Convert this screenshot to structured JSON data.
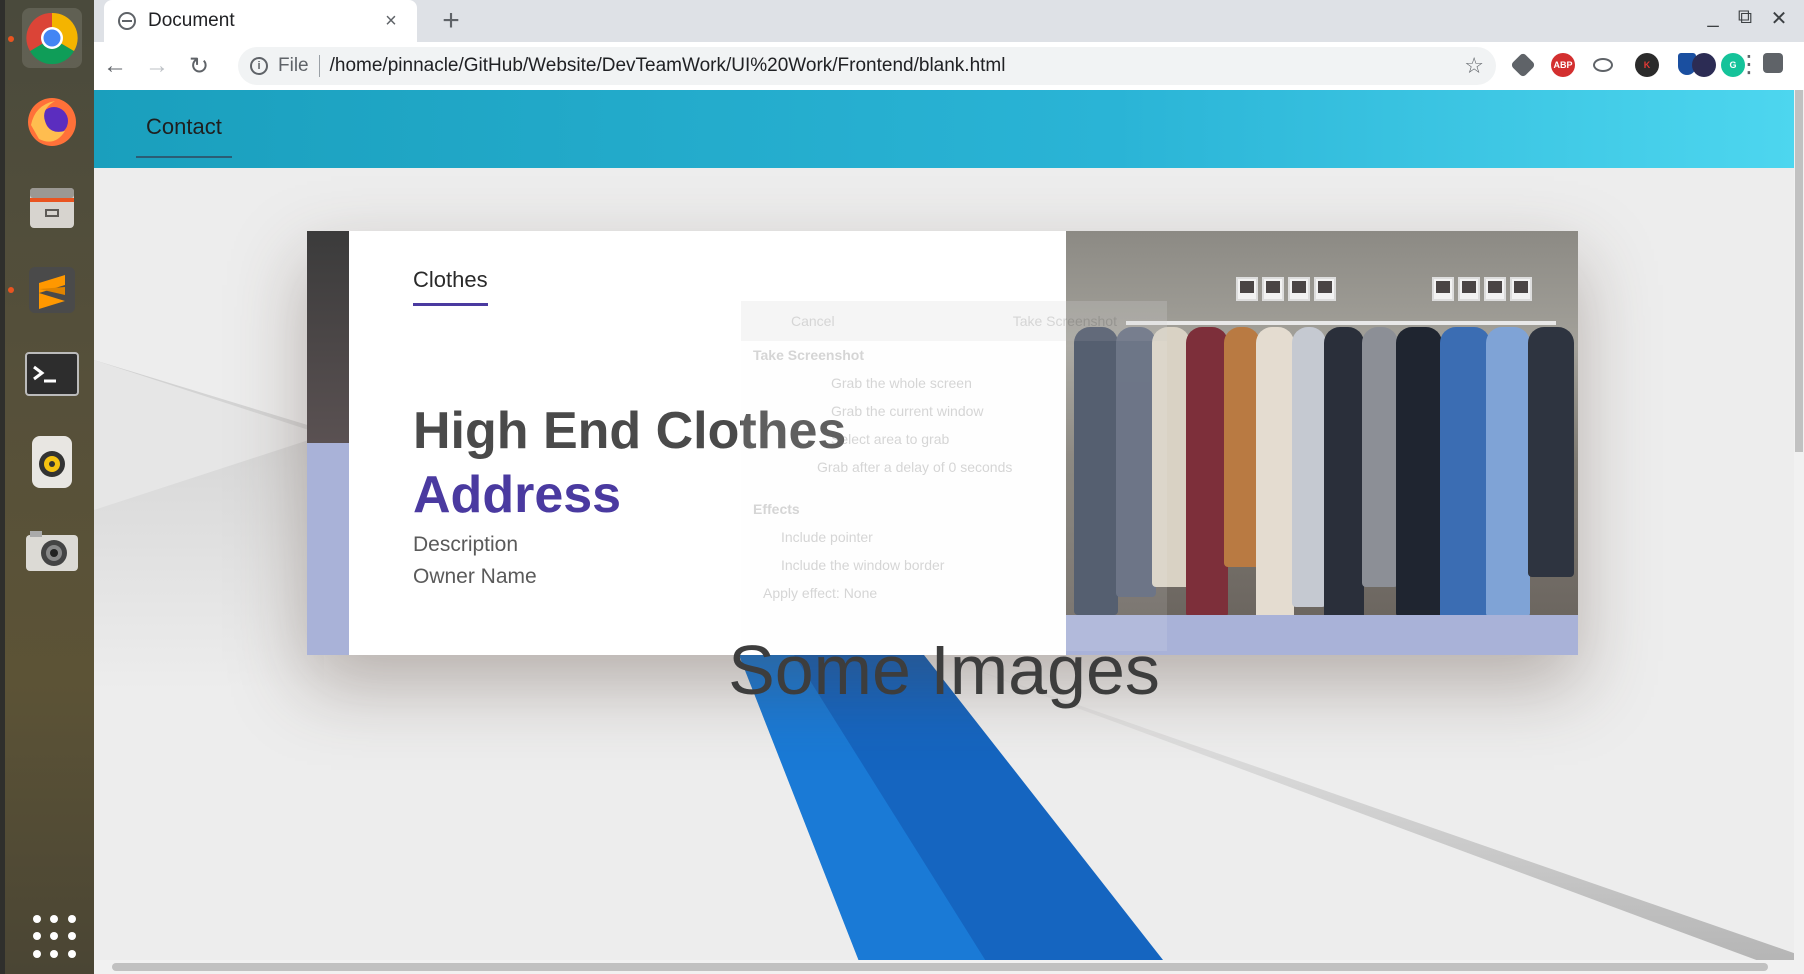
{
  "dock": {
    "apps": [
      "chrome-icon",
      "firefox-icon",
      "files-icon",
      "sublime-text-icon",
      "terminal-icon",
      "rhythmbox-icon",
      "screenshot-icon"
    ],
    "show_apps": "apps-grid-icon"
  },
  "browser": {
    "tab": {
      "title": "Document",
      "close": "×"
    },
    "new_tab": "+",
    "window_controls": {
      "minimize": "_",
      "restore": "⧉",
      "close": "✕"
    },
    "nav": {
      "back": "←",
      "forward": "→",
      "reload": "↻"
    },
    "omnibox": {
      "info": "i",
      "scheme": "File",
      "url": "/home/pinnacle/GitHub/Website/DevTeamWork/UI%20Work/Frontend/blank.html"
    },
    "star": "☆",
    "extensions": [
      {
        "name": "extension-icon",
        "label": ""
      },
      {
        "name": "adblock-plus-icon",
        "label": "ABP"
      },
      {
        "name": "extension-icon",
        "label": ""
      },
      {
        "name": "kaspersky-icon",
        "label": "K"
      },
      {
        "name": "shield-extension-icon",
        "label": ""
      },
      {
        "name": "grammarly-icon",
        "label": "G"
      },
      {
        "name": "extension-icon",
        "label": ""
      },
      {
        "name": "profile-avatar-icon",
        "label": ""
      }
    ],
    "menu": "⋮"
  },
  "page": {
    "navbar": {
      "link": "Contact"
    },
    "card": {
      "tab_label": "Clothes",
      "title": "High End Clothes",
      "address": "Address",
      "description": "Description",
      "owner": "Owner Name"
    },
    "section_heading": "Some Images"
  },
  "ghost_dialog": {
    "cancel": "Cancel",
    "take": "Take Screenshot",
    "heading": "Take Screenshot",
    "opt1": "Grab the whole screen",
    "opt2": "Grab the current window",
    "opt3": "Select area to grab",
    "delay_label": "Grab after a delay of",
    "delay_value": "0",
    "delay_unit": "seconds",
    "effects": "Effects",
    "pointer": "Include pointer",
    "border": "Include the window border",
    "apply": "Apply effect:",
    "apply_value": "None"
  },
  "colors": {
    "navbar_start": "#1a9fbd",
    "navbar_end": "#4dd6ef",
    "accent_purple": "#4a3aa0",
    "lavender": "#a9b2d8",
    "diagonal_blue": "#1565c0"
  }
}
